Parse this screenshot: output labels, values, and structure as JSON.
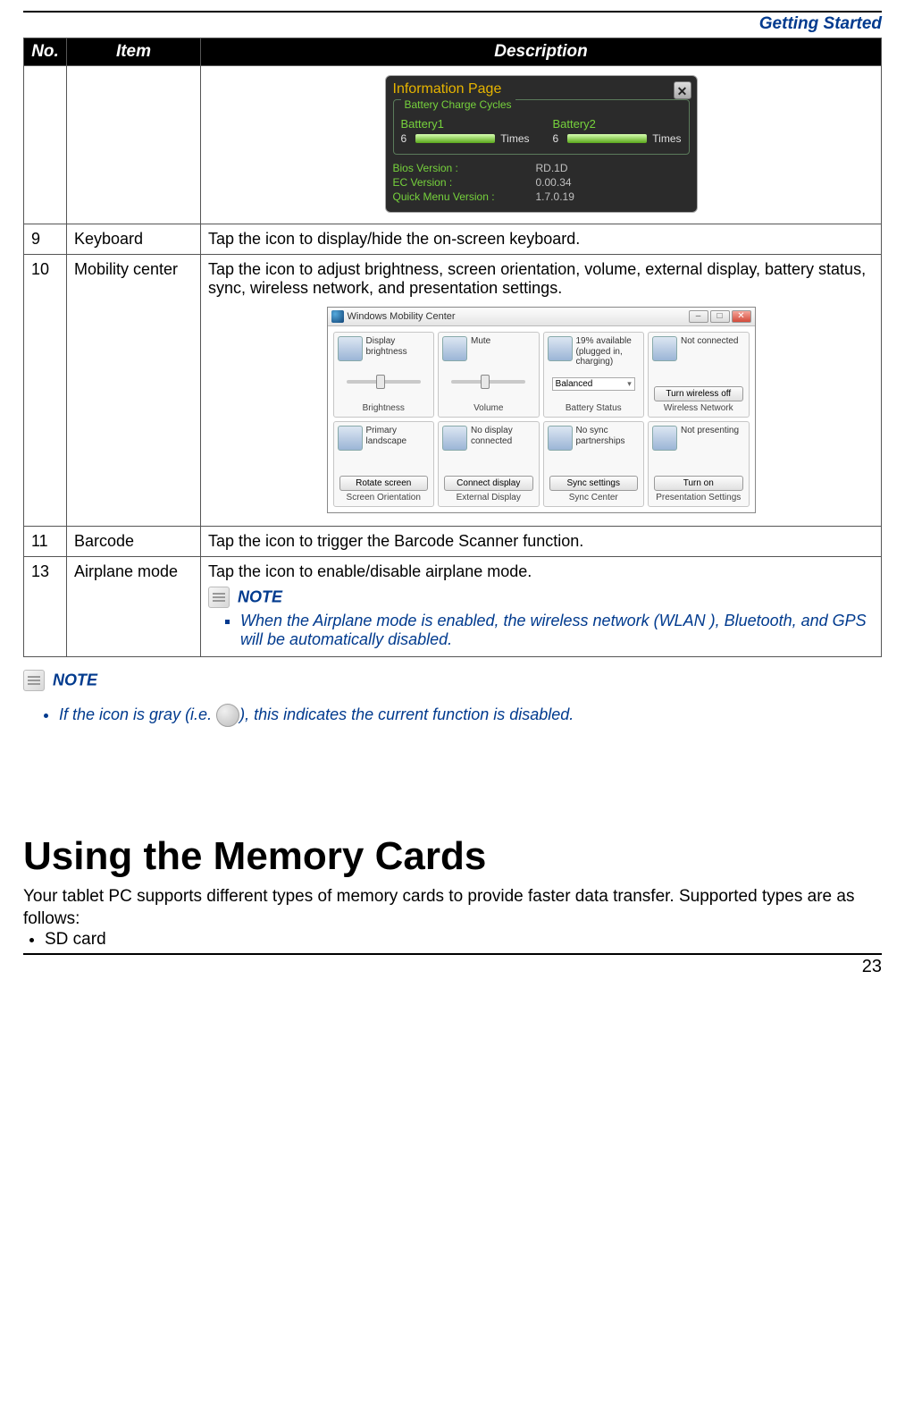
{
  "header": {
    "section": "Getting Started"
  },
  "table": {
    "headers": {
      "no": "No.",
      "item": "Item",
      "desc": "Description"
    },
    "rows": {
      "r9": {
        "no": "9",
        "item": "Keyboard",
        "desc": "Tap the icon to display/hide the on-screen keyboard."
      },
      "r10": {
        "no": "10",
        "item": "Mobility center",
        "desc": "Tap the icon to adjust brightness, screen orientation, volume, external display, battery status, sync, wireless network, and presentation settings."
      },
      "r11": {
        "no": "11",
        "item": "Barcode",
        "desc": "Tap the icon to trigger the Barcode Scanner function."
      },
      "r13": {
        "no": "13",
        "item": "Airplane mode",
        "desc": "Tap the icon to enable/disable airplane mode.",
        "note_label": "NOTE",
        "note_item": "When the Airplane mode is enabled, the wireless network (WLAN ), Bluetooth, and GPS will be automatically disabled."
      }
    }
  },
  "info_page": {
    "title": "Information Page",
    "close_glyph": "✕",
    "box_label": "Battery Charge Cycles",
    "bat1": "Battery1",
    "bat2": "Battery2",
    "val1": "6",
    "val2": "6",
    "times": "Times",
    "rows": {
      "bios_k": "Bios Version :",
      "bios_v": "RD.1D",
      "ec_k": "EC Version :",
      "ec_v": "0.00.34",
      "qm_k": "Quick Menu Version :",
      "qm_v": "1.7.0.19"
    }
  },
  "mobility": {
    "title": "Windows Mobility Center",
    "tiles": {
      "t1": {
        "text": "Display brightness",
        "btn": "Brightness",
        "caption": "Brightness"
      },
      "t2": {
        "text": "Mute",
        "btn": "Volume",
        "caption": "Volume"
      },
      "t3": {
        "text": "19% available (plugged in, charging)",
        "combo": "Balanced",
        "btn": "Battery Status",
        "caption": "Battery Status"
      },
      "t4": {
        "text": "Not connected",
        "btn": "Turn wireless off",
        "caption": "Wireless Network"
      },
      "t5": {
        "text": "Primary landscape",
        "btn": "Rotate screen",
        "caption": "Screen Orientation"
      },
      "t6": {
        "text": "No display connected",
        "btn": "Connect display",
        "caption": "External Display"
      },
      "t7": {
        "text": "No sync partnerships",
        "btn": "Sync settings",
        "caption": "Sync Center"
      },
      "t8": {
        "text": "Not presenting",
        "btn": "Turn on",
        "caption": "Presentation Settings"
      }
    }
  },
  "outer_note": {
    "label": "NOTE",
    "item_pre": "If the icon is gray (i.e. ",
    "item_post": "), this indicates the current function is disabled."
  },
  "memory": {
    "heading": "Using the Memory Cards",
    "para": "Your tablet PC supports different types of memory cards to provide faster data transfer. Supported types are as follows:",
    "b1": "SD card"
  },
  "footer": {
    "page": "23"
  }
}
